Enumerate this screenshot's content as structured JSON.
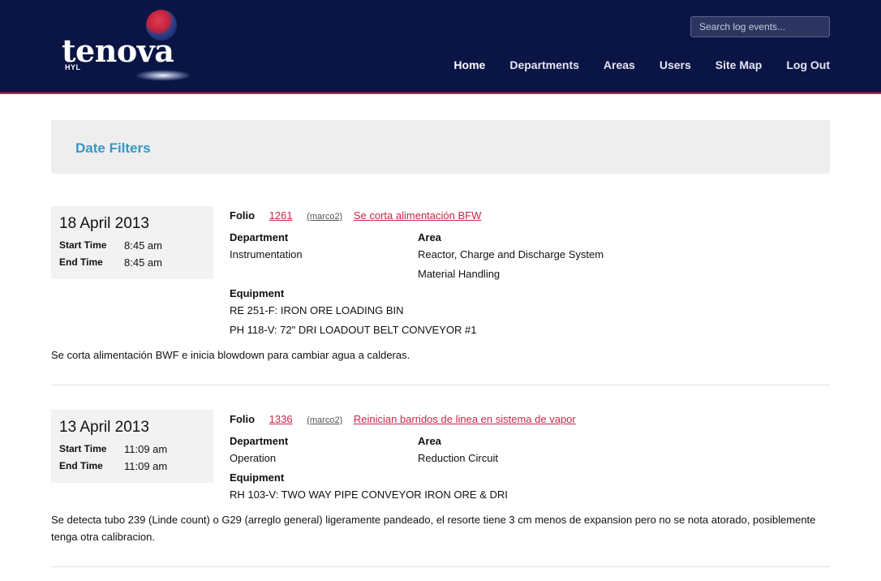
{
  "brand": {
    "name": "tenova",
    "sub": "HYL"
  },
  "search": {
    "placeholder": "Search log events..."
  },
  "nav": [
    {
      "label": "Home"
    },
    {
      "label": "Departments"
    },
    {
      "label": "Areas"
    },
    {
      "label": "Users"
    },
    {
      "label": "Site Map"
    },
    {
      "label": "Log Out"
    }
  ],
  "filters": {
    "title": "Date Filters"
  },
  "labels": {
    "start_time": "Start Time",
    "end_time": "End Time",
    "folio": "Folio",
    "department": "Department",
    "area": "Area",
    "equipment": "Equipment"
  },
  "entries": [
    {
      "date": "18 April 2013",
      "start": "8:45 am",
      "end": "8:45 am",
      "folio": "1261",
      "user": "(marco2)",
      "title": "Se corta alimentación BFW",
      "department": "Instrumentation",
      "areas": [
        "Reactor, Charge and Discharge System",
        "Material Handling"
      ],
      "equipment": [
        "RE 251-F: IRON ORE LOADING BIN",
        "PH 118-V: 72\" DRI LOADOUT BELT CONVEYOR #1"
      ],
      "description": "Se corta alimentación BWF e inicia blowdown para cambiar agua a calderas."
    },
    {
      "date": "13 April 2013",
      "start": "11:09 am",
      "end": "11:09 am",
      "folio": "1336",
      "user": "(marco2)",
      "title": "Reinician barridos de linea en sistema de vapor",
      "department": "Operation",
      "areas": [
        "Reduction Circuit"
      ],
      "equipment": [
        "RH 103-V: TWO WAY PIPE CONVEYOR IRON ORE & DRI"
      ],
      "description": "Se detecta tubo 239 (Linde count) o G29 (arreglo general) ligeramente pandeado, el resorte tiene 3 cm menos de expansion pero no se nota atorado, posiblemente tenga otra calibracion."
    }
  ],
  "colors": {
    "header_bg": "#0a1545",
    "accent": "#c8264a",
    "link_blue": "#3596c8"
  }
}
